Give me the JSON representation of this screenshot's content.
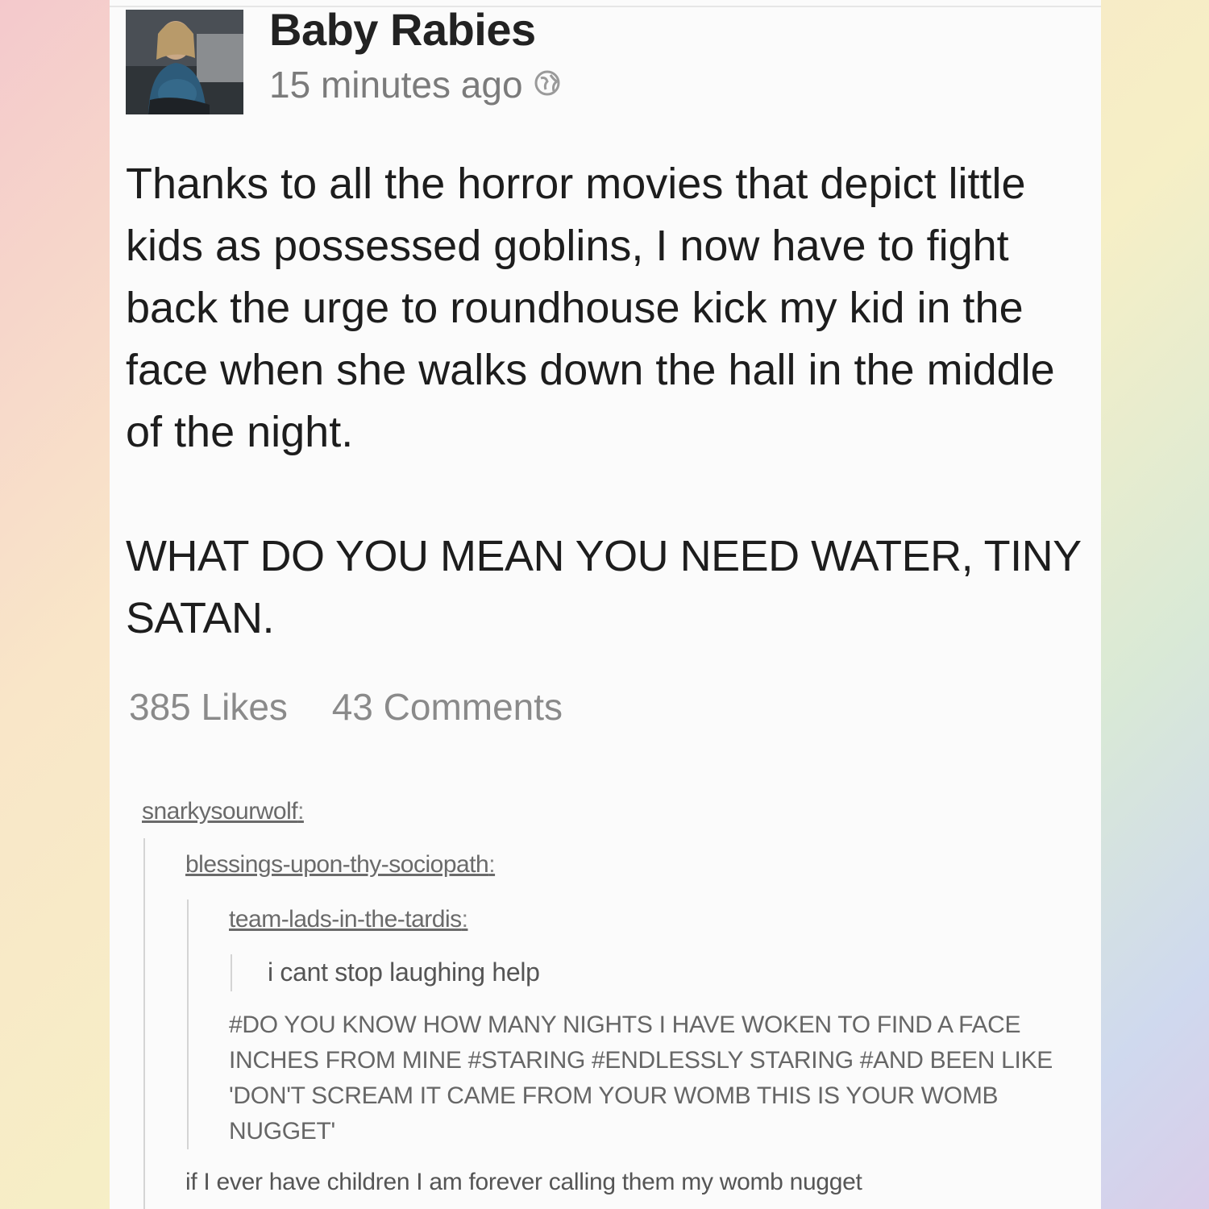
{
  "post": {
    "author": "Baby Rabies",
    "time": "15 minutes ago",
    "body": "Thanks to all the horror movies that depict little kids as possessed goblins, I now have to fight back the urge to roundhouse kick my kid in the face when she walks down the hall in the middle of the night.",
    "shout": "WHAT DO YOU MEAN YOU NEED WATER, TINY SATAN.",
    "likes": "385 Likes",
    "comments": "43 Comments"
  },
  "reblogs": {
    "user1": "snarkysourwolf",
    "user2": "blessings-upon-thy-sociopath",
    "user3": "team-lads-in-the-tardis",
    "colon": ":",
    "comment1": "i cant stop laughing help",
    "tags": "#DO YOU KNOW HOW MANY NIGHTS I HAVE WOKEN TO FIND A FACE INCHES FROM MINE #STARING #ENDLESSLY STARING #AND BEEN LIKE 'DON'T SCREAM IT CAME FROM YOUR WOMB THIS IS YOUR WOMB NUGGET'",
    "final_comment": "if I ever have children I am forever calling them my womb nugget"
  },
  "icons": {
    "avatar": "profile-photo",
    "privacy": "globe-icon"
  },
  "colors": {
    "card": "#fbfbfb",
    "text": "#1d1d1d",
    "muted": "#8a8a8a"
  }
}
